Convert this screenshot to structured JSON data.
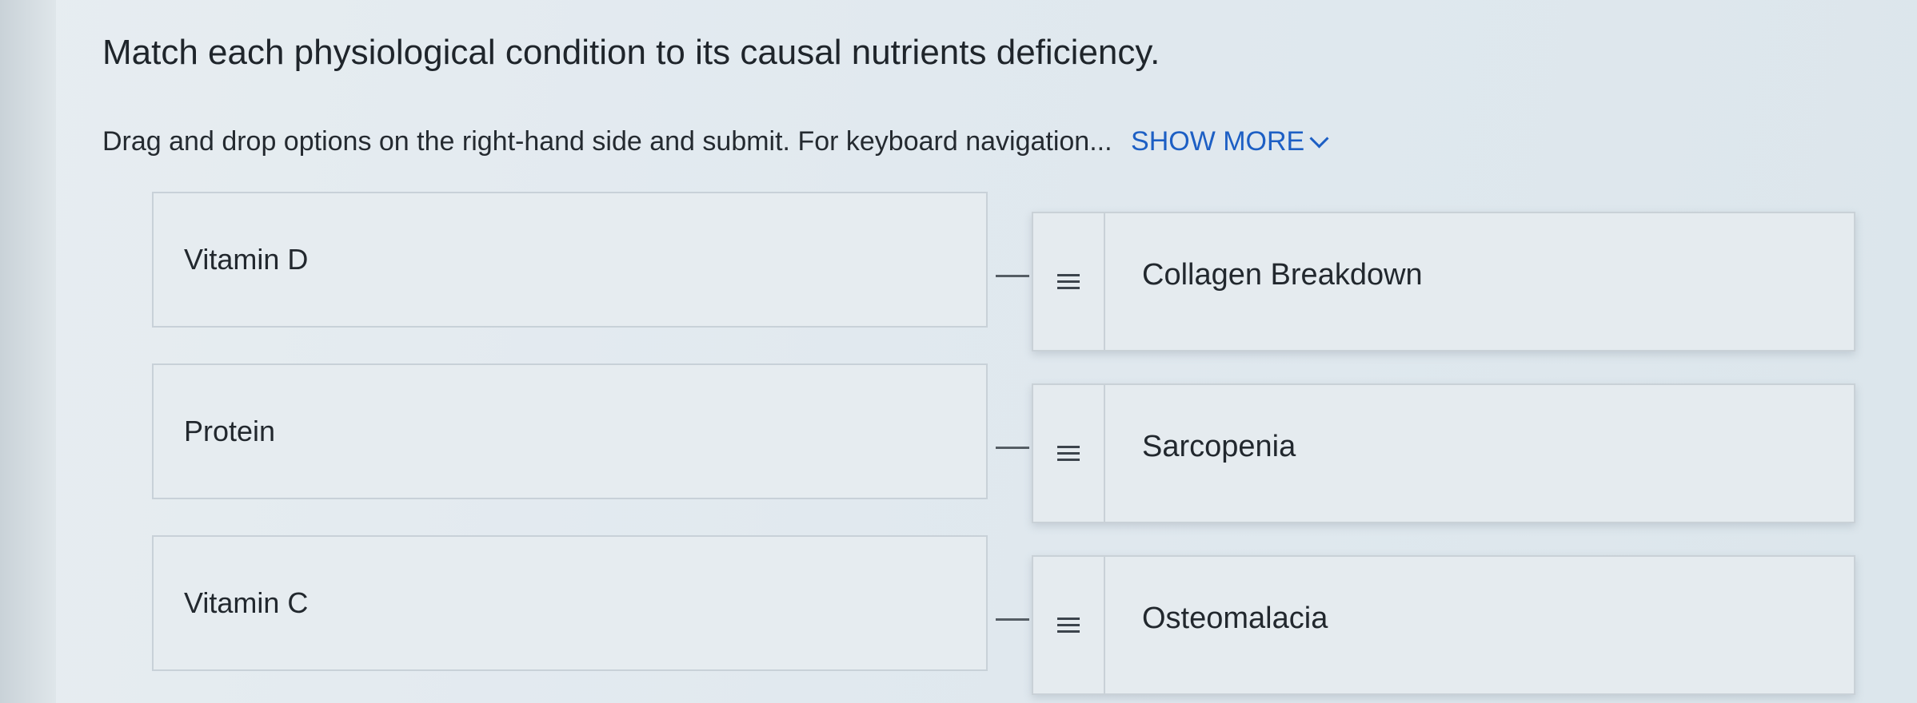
{
  "question": {
    "title": "Match each physiological condition to its causal nutrients deficiency.",
    "instructions": "Drag and drop options on the right-hand side and submit. For keyboard navigation...",
    "show_more_label": "SHOW MORE",
    "show_more_icon": "chevron-down-icon"
  },
  "matches": [
    {
      "prompt": "Vitamin D",
      "option": "Collagen Breakdown",
      "handle_icon": "drag-handle-icon"
    },
    {
      "prompt": "Protein",
      "option": "Sarcopenia",
      "handle_icon": "drag-handle-icon"
    },
    {
      "prompt": "Vitamin C",
      "option": "Osteomalacia",
      "handle_icon": "drag-handle-icon"
    }
  ],
  "colors": {
    "link": "#1d5fc4",
    "text": "#22282e",
    "card_border": "#c9d1d7"
  }
}
